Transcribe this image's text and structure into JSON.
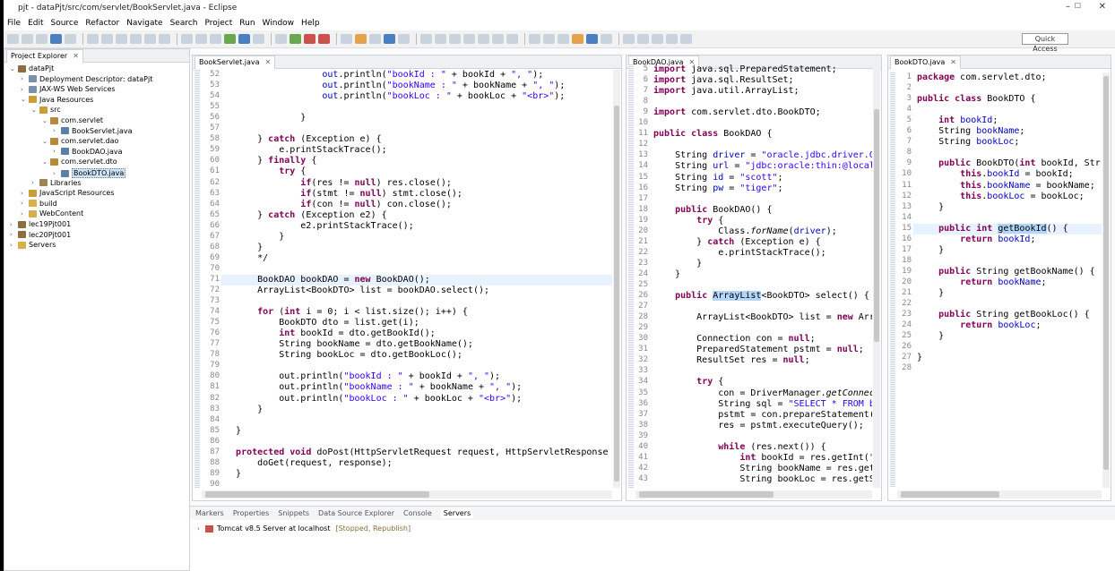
{
  "window": {
    "title": "pjt - dataPjt/src/com/servlet/BookServlet.java - Eclipse",
    "minimize": "–",
    "maximize": "☐",
    "close": "✕"
  },
  "menu": [
    "File",
    "Edit",
    "Source",
    "Refactor",
    "Navigate",
    "Search",
    "Project",
    "Run",
    "Window",
    "Help"
  ],
  "toolbar": {
    "quick_access": "Quick Access"
  },
  "explorer": {
    "tab": "Project Explorer",
    "items": [
      {
        "label": "dataPjt",
        "depth": 0,
        "arrow": "⌄",
        "type": "project"
      },
      {
        "label": "Deployment Descriptor: dataPjt",
        "depth": 1,
        "arrow": "›",
        "type": "desc"
      },
      {
        "label": "JAX-WS Web Services",
        "depth": 1,
        "arrow": "›",
        "type": "ws"
      },
      {
        "label": "Java Resources",
        "depth": 1,
        "arrow": "⌄",
        "type": "res"
      },
      {
        "label": "src",
        "depth": 2,
        "arrow": "⌄",
        "type": "src"
      },
      {
        "label": "com.servlet",
        "depth": 3,
        "arrow": "⌄",
        "type": "pkg"
      },
      {
        "label": "BookServlet.java",
        "depth": 4,
        "arrow": "›",
        "type": "java"
      },
      {
        "label": "com.servlet.dao",
        "depth": 3,
        "arrow": "⌄",
        "type": "pkg"
      },
      {
        "label": "BookDAO.java",
        "depth": 4,
        "arrow": "›",
        "type": "java"
      },
      {
        "label": "com.servlet.dto",
        "depth": 3,
        "arrow": "⌄",
        "type": "pkg"
      },
      {
        "label": "BookDTO.java",
        "depth": 4,
        "arrow": "›",
        "type": "java",
        "selected": true
      },
      {
        "label": "Libraries",
        "depth": 2,
        "arrow": "›",
        "type": "lib"
      },
      {
        "label": "JavaScript Resources",
        "depth": 1,
        "arrow": "›",
        "type": "js"
      },
      {
        "label": "build",
        "depth": 1,
        "arrow": "›",
        "type": "folder"
      },
      {
        "label": "WebContent",
        "depth": 1,
        "arrow": "›",
        "type": "folder"
      },
      {
        "label": "lec19Pjt001",
        "depth": 0,
        "arrow": "›",
        "type": "project"
      },
      {
        "label": "lec20Pjt001",
        "depth": 0,
        "arrow": "›",
        "type": "project"
      },
      {
        "label": "Servers",
        "depth": 0,
        "arrow": "›",
        "type": "folder"
      }
    ]
  },
  "editor1": {
    "tab": "BookServlet.java",
    "first_line": 52,
    "lines": [
      "                  <span class=\"fd\">out</span>.println(<span class=\"st\">\"bookId : \"</span> + bookId + <span class=\"st\">\", \"</span>);",
      "                  <span class=\"fd\">out</span>.println(<span class=\"st\">\"bookName : \"</span> + bookName + <span class=\"st\">\", \"</span>);",
      "                  <span class=\"fd\">out</span>.println(<span class=\"st\">\"bookLoc : \"</span> + bookLoc + <span class=\"st\">\"&lt;br&gt;\"</span>);",
      "",
      "              }",
      "",
      "      } <span class=\"kw\">catch</span> (Exception e) {",
      "          e.printStackTrace();",
      "      } <span class=\"kw\">finally</span> {",
      "          <span class=\"kw\">try</span> {",
      "              <span class=\"kw\">if</span>(res != <span class=\"kw\">null</span>) res.close();",
      "              <span class=\"kw\">if</span>(stmt != <span class=\"kw\">null</span>) stmt.close();",
      "              <span class=\"kw\">if</span>(con != <span class=\"kw\">null</span>) con.close();",
      "      } <span class=\"kw\">catch</span> (Exception e2) {",
      "              e2.printStackTrace();",
      "          }",
      "      }",
      "      */",
      "",
      "      BookDAO bookDAO = <span class=\"kw\">new</span> BookDAO();",
      "      ArrayList&lt;BookDTO&gt; list = bookDAO.select();",
      "",
      "      <span class=\"kw\">for</span> (<span class=\"kw\">int</span> i = 0; i &lt; list.size(); i++) {",
      "          BookDTO dto = list.get(i);",
      "          <span class=\"kw\">int</span> bookId = dto.getBookId();",
      "          String bookName = dto.getBookName();",
      "          String bookLoc = dto.getBookLoc();",
      "",
      "          out.println(<span class=\"st\">\"bookId : \"</span> + bookId + <span class=\"st\">\", \"</span>);",
      "          out.println(<span class=\"st\">\"bookName : \"</span> + bookName + <span class=\"st\">\", \"</span>);",
      "          out.println(<span class=\"st\">\"bookLoc : \"</span> + bookLoc + <span class=\"st\">\"&lt;br&gt;\"</span>);",
      "      }",
      "",
      "  }",
      "",
      "  <span class=\"kw\">protected</span> <span class=\"kw\">void</span> doPost(HttpServletRequest request, HttpServletResponse",
      "      doGet(request, response);",
      "  }",
      ""
    ]
  },
  "editor2": {
    "tab": "BookDAO.java",
    "first_line": 5,
    "lines": [
      "<span class=\"kw\">import</span> java.sql.PreparedStatement;",
      "<span class=\"kw\">import</span> java.sql.ResultSet;",
      "<span class=\"kw\">import</span> java.util.ArrayList;",
      "",
      "<span class=\"kw\">import</span> com.servlet.dto.BookDTO;",
      "",
      "<span class=\"kw\">public</span> <span class=\"kw\">class</span> BookDAO {",
      "",
      "    String <span class=\"fd\">driver</span> = <span class=\"st\">\"oracle.jdbc.driver.Or</span>",
      "    String <span class=\"fd\">url</span> = <span class=\"st\">\"jdbc:oracle:thin:@localh</span>",
      "    String <span class=\"fd\">id</span> = <span class=\"st\">\"scott\"</span>;",
      "    String <span class=\"fd\">pw</span> = <span class=\"st\">\"tiger\"</span>;",
      "",
      "    <span class=\"kw\">public</span> BookDAO() {",
      "        <span class=\"kw\">try</span> {",
      "            Class.<span class=\"ital\">forName</span>(<span class=\"fd\">driver</span>);",
      "        } <span class=\"kw\">catch</span> (Exception e) {",
      "            e.printStackTrace();",
      "        }",
      "    }",
      "",
      "    <span class=\"kw\">public</span> <span class=\"hl\">ArrayList</span>&lt;BookDTO&gt; select() {",
      "",
      "        ArrayList&lt;BookDTO&gt; list = <span class=\"kw\">new</span> Arra",
      "",
      "        Connection con = <span class=\"kw\">null</span>;",
      "        PreparedStatement pstmt = <span class=\"kw\">null</span>;",
      "        ResultSet res = <span class=\"kw\">null</span>;",
      "",
      "        <span class=\"kw\">try</span> {",
      "            con = DriverManager.<span class=\"ital\">getConnect</span>",
      "            String sql = <span class=\"st\">\"SELECT * FROM bo</span>",
      "            pstmt = con.prepareStatement(s",
      "            res = pstmt.executeQuery();",
      "",
      "            <span class=\"kw\">while</span> (res.next()) {",
      "                <span class=\"kw\">int</span> bookId = res.getInt(<span class=\"st\">\"b</span>",
      "                String bookName = res.getS",
      "                String bookLoc = res.getSt"
    ]
  },
  "editor3": {
    "tab": "BookDTO.java",
    "first_line": 1,
    "lines": [
      "<span class=\"kw\">package</span> com.servlet.dto;",
      "",
      "<span class=\"kw\">public</span> <span class=\"kw\">class</span> BookDTO {",
      "",
      "    <span class=\"kw\">int</span> <span class=\"fd\">bookId</span>;",
      "    String <span class=\"fd\">bookName</span>;",
      "    String <span class=\"fd\">bookLoc</span>;",
      "",
      "    <span class=\"kw\">public</span> BookDTO(<span class=\"kw\">int</span> bookId, Str",
      "        <span class=\"kw\">this</span>.<span class=\"fd\">bookId</span> = bookId;",
      "        <span class=\"kw\">this</span>.<span class=\"fd\">bookName</span> = bookName;",
      "        <span class=\"kw\">this</span>.<span class=\"fd\">bookLoc</span> = bookLoc;",
      "    }",
      "",
      "    <span class=\"kw\">public</span> <span class=\"kw\">int</span> <span class=\"hl\">getBookId</span>() {",
      "        <span class=\"kw\">return</span> <span class=\"fd\">bookId</span>;",
      "    }",
      "",
      "    <span class=\"kw\">public</span> String getBookName() {",
      "        <span class=\"kw\">return</span> <span class=\"fd\">bookName</span>;",
      "    }",
      "",
      "    <span class=\"kw\">public</span> String getBookLoc() {",
      "        <span class=\"kw\">return</span> <span class=\"fd\">bookLoc</span>;",
      "    }",
      "",
      "}",
      ""
    ]
  },
  "bottom": {
    "tabs": [
      "Markers",
      "Properties",
      "Snippets",
      "Data Source Explorer",
      "Console",
      "Servers"
    ],
    "active_tab": "Servers",
    "server_name": "Tomcat v8.5 Server at localhost",
    "server_status": "[Stopped, Republish]"
  }
}
